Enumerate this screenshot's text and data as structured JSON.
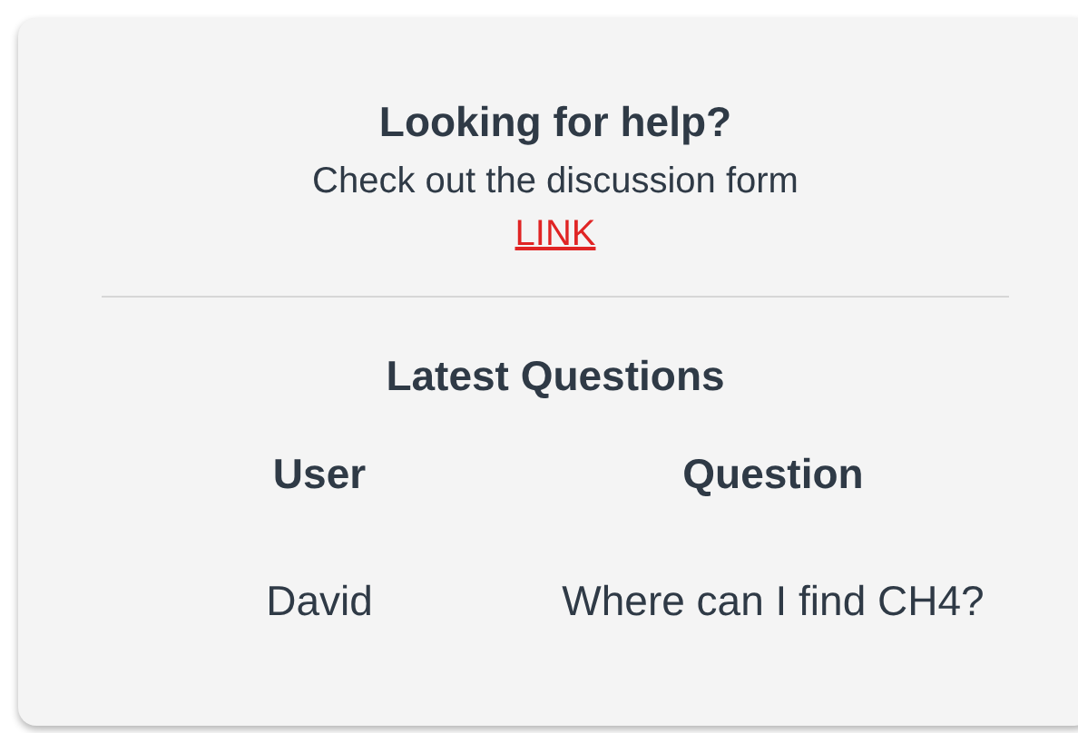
{
  "help": {
    "title": "Looking for help?",
    "text": "Check out the discussion form",
    "link": "LINK"
  },
  "questions": {
    "title": "Latest Questions",
    "columns": [
      "User",
      "Question"
    ],
    "rows": [
      {
        "user": "David",
        "question": "Where can I find CH4?"
      }
    ]
  }
}
